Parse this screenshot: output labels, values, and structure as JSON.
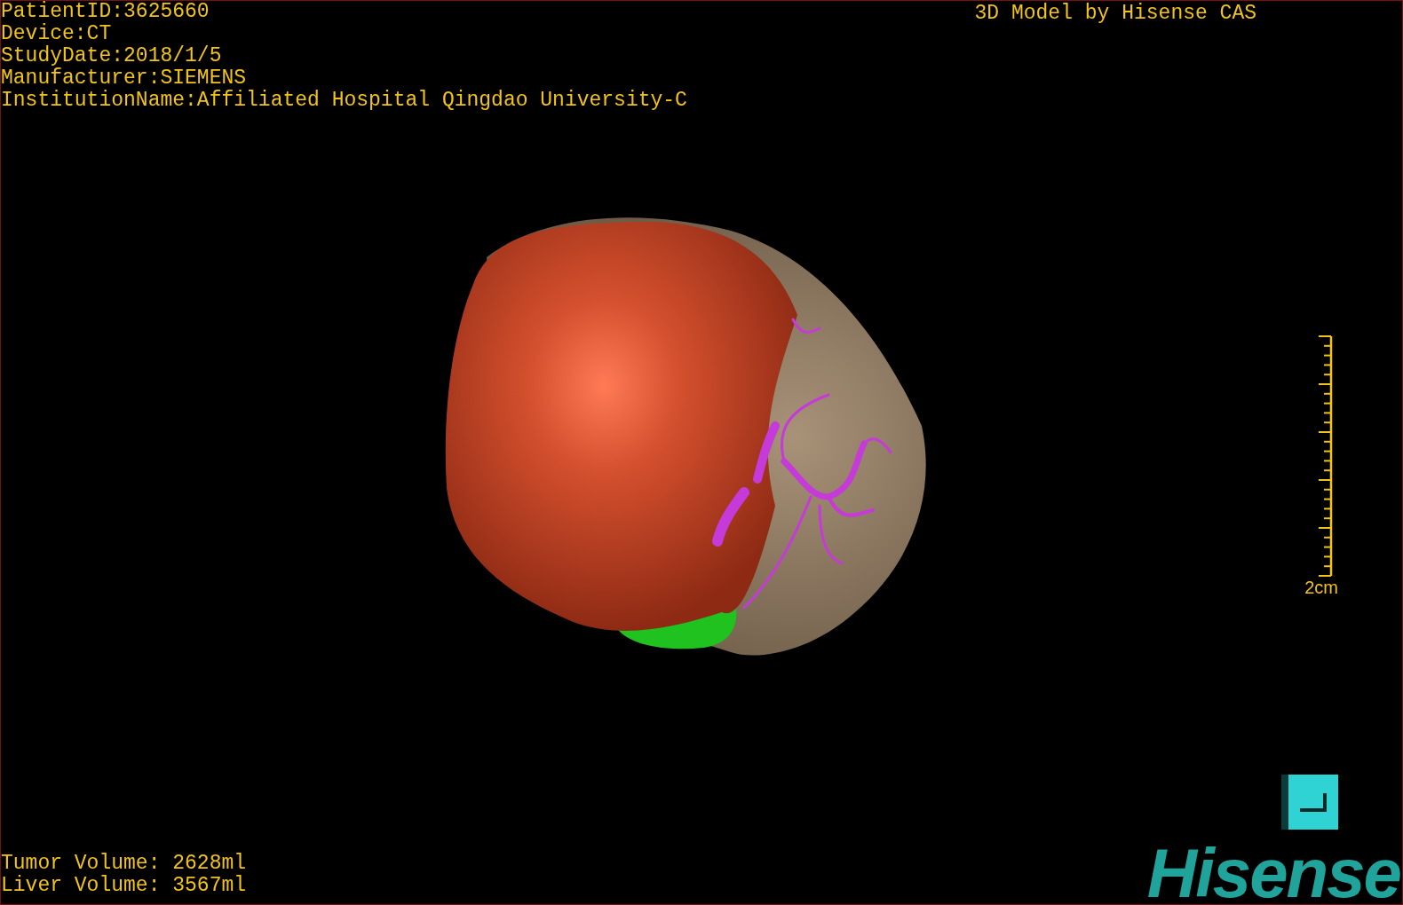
{
  "patient_info": [
    "PatientID:3625660",
    "Device:CT",
    "StudyDate:2018/1/5",
    "Manufacturer:SIEMENS",
    "InstitutionName:Affiliated Hospital Qingdao University-C"
  ],
  "title": "3D Model by Hisense CAS",
  "scale_bar": {
    "label": "2cm"
  },
  "volumes": [
    "Tumor Volume: 2628ml",
    "Liver Volume: 3567ml"
  ],
  "logo": "Hisense"
}
